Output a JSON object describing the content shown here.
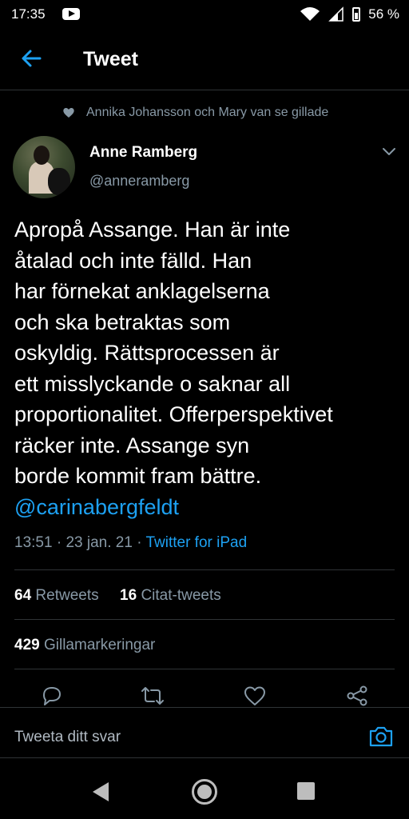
{
  "status_bar": {
    "time": "17:35",
    "battery": "56 %",
    "icons": [
      "youtube-icon",
      "wifi-icon",
      "signal-icon",
      "battery-icon"
    ]
  },
  "header": {
    "title": "Tweet",
    "back_icon": "arrow-left-icon",
    "accent_color": "#1da1f2"
  },
  "social_context": {
    "text": "Annika Johansson och Mary van se gillade",
    "icon": "heart-icon"
  },
  "author": {
    "name": "Anne Ramberg",
    "handle": "@anneramberg"
  },
  "tweet": {
    "lines": [
      "Apropå Assange. Han är inte",
      "åtalad och inte fälld. Han",
      "har förnekat anklagelserna",
      "och ska betraktas som",
      "oskyldig. Rättsprocessen är",
      "ett misslyckande o saknar all",
      "proportionalitet. Offerperspektivet",
      "räcker inte. Assange syn",
      "borde kommit fram bättre."
    ],
    "mention": "@carinabergfeldt"
  },
  "meta": {
    "time": "13:51",
    "separator": "·",
    "date": "23 jan. 21",
    "source": "Twitter for iPad"
  },
  "stats": {
    "retweets_count": "64",
    "retweets_label": "Retweets",
    "quotes_count": "16",
    "quotes_label": "Citat-tweets",
    "likes_count": "429",
    "likes_label": "Gillamarkeringar"
  },
  "actions": [
    "reply-icon",
    "retweet-icon",
    "like-icon",
    "share-icon"
  ],
  "reply": {
    "placeholder": "Tweeta ditt svar",
    "camera_icon": "camera-icon"
  },
  "nav": [
    "back-triangle-icon",
    "home-circle-icon",
    "recents-square-icon"
  ]
}
